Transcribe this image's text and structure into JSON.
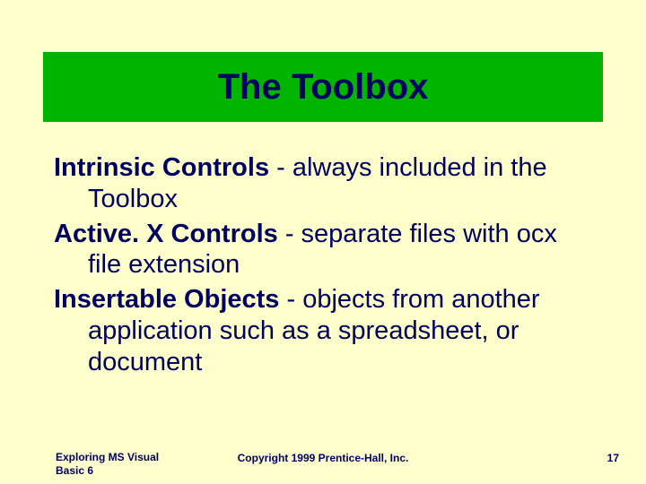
{
  "title": "The Toolbox",
  "items": [
    {
      "term": "Intrinsic Controls",
      "desc": " - always included in the Toolbox"
    },
    {
      "term": "Active. X Controls",
      "desc": " - separate files with ocx file extension"
    },
    {
      "term": "Insertable Objects",
      "desc": " - objects from another application such as a spreadsheet, or document"
    }
  ],
  "footer": {
    "left": "Exploring MS Visual Basic 6",
    "center": "Copyright 1999 Prentice-Hall, Inc.",
    "right": "17"
  }
}
